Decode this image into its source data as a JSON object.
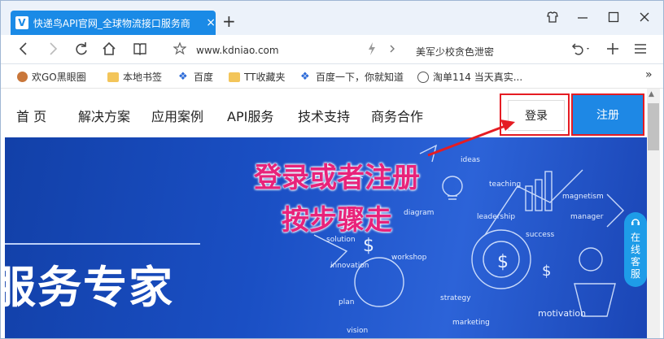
{
  "browser": {
    "tab_title": "快递鸟API官网_全球物流接口服务商",
    "tab_close": "×",
    "new_tab": "+",
    "url": "www.kdniao.com",
    "search_text": "美军少校贪色泄密",
    "bookmarks": [
      {
        "label": "欢GO黑眼圈"
      },
      {
        "label": "本地书签"
      },
      {
        "label": "百度"
      },
      {
        "label": "TT收藏夹"
      },
      {
        "label": "百度一下，你就知道"
      },
      {
        "label": "淘单114 当天真实..."
      }
    ],
    "bookmarks_more": "»"
  },
  "site": {
    "menu": [
      "首 页",
      "解决方案",
      "应用案例",
      "API服务",
      "技术支持",
      "商务合作"
    ],
    "login_label": "登录",
    "register_label": "注册",
    "hero_title": "服务专家",
    "online_service": [
      "在",
      "线",
      "客",
      "服"
    ],
    "hero_words": [
      "ideas",
      "teaching",
      "leadership",
      "diagram",
      "success",
      "solution",
      "workshop",
      "innovation",
      "plan",
      "strategy",
      "manager",
      "motivation",
      "marketing",
      "vision",
      "magnetism"
    ]
  },
  "annotation": {
    "line1": "登录或者注册",
    "line2": "按步骤走"
  },
  "colors": {
    "tab_blue": "#1a8ae6",
    "register_blue": "#1e88e5",
    "highlight_red": "#e51c23",
    "annotation_pink": "#e8237a",
    "hero_blue": "#1a4fc4"
  }
}
